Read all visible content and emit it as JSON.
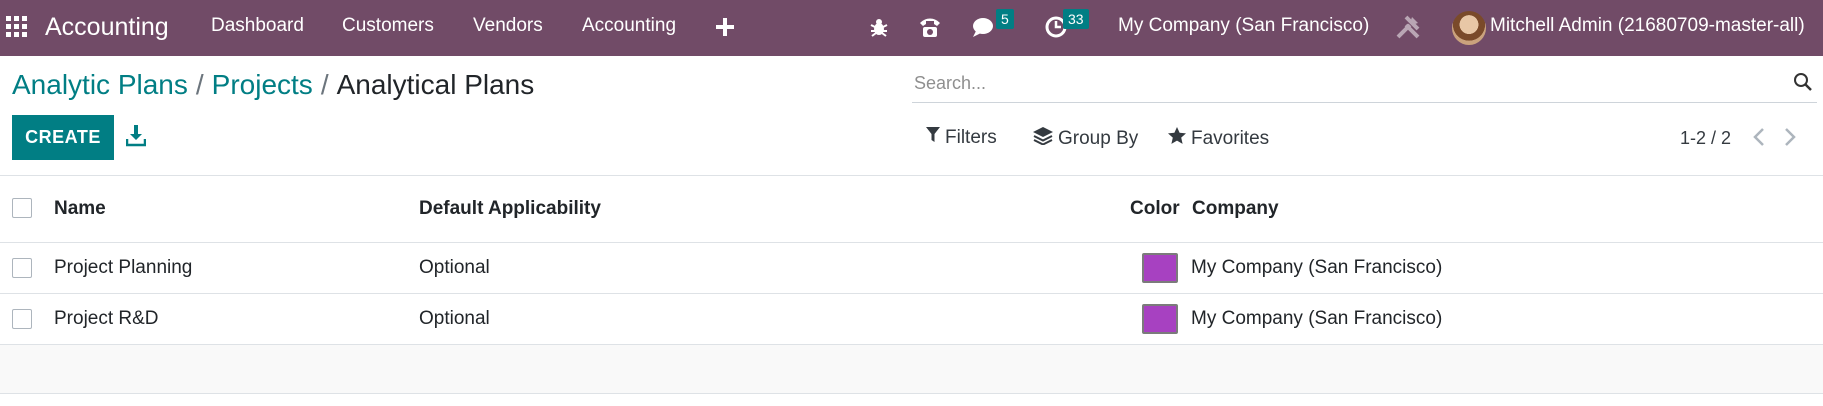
{
  "navbar": {
    "brand": "Accounting",
    "menu": [
      "Dashboard",
      "Customers",
      "Vendors",
      "Accounting"
    ],
    "icons": [
      "apps-grid-icon",
      "plus-icon",
      "bug-icon",
      "phone-icon",
      "chat-icon",
      "clock-icon",
      "tools-icon"
    ],
    "chat_badge": "5",
    "activity_badge": "33",
    "company": "My Company (San Francisco)",
    "user": "Mitchell Admin (21680709-master-all)"
  },
  "breadcrumb": {
    "items": [
      "Analytic Plans",
      "Projects"
    ],
    "separator": "/",
    "current": "Analytical Plans"
  },
  "search": {
    "placeholder": "Search..."
  },
  "actions": {
    "create_label": "CREATE"
  },
  "filters": {
    "filters_label": "Filters",
    "group_by_label": "Group By",
    "favorites_label": "Favorites"
  },
  "pager": {
    "value": "1-2 / 2"
  },
  "table": {
    "columns": [
      "Name",
      "Default Applicability",
      "Color",
      "Company"
    ],
    "rows": [
      {
        "name": "Project Planning",
        "applicability": "Optional",
        "color": "#A741C1",
        "company": "My Company (San Francisco)"
      },
      {
        "name": "Project R&D",
        "applicability": "Optional",
        "color": "#A741C1",
        "company": "My Company (San Francisco)"
      }
    ]
  },
  "colors": {
    "navbar": "#714B67",
    "accent": "#017E84",
    "badge": "#017E84"
  }
}
